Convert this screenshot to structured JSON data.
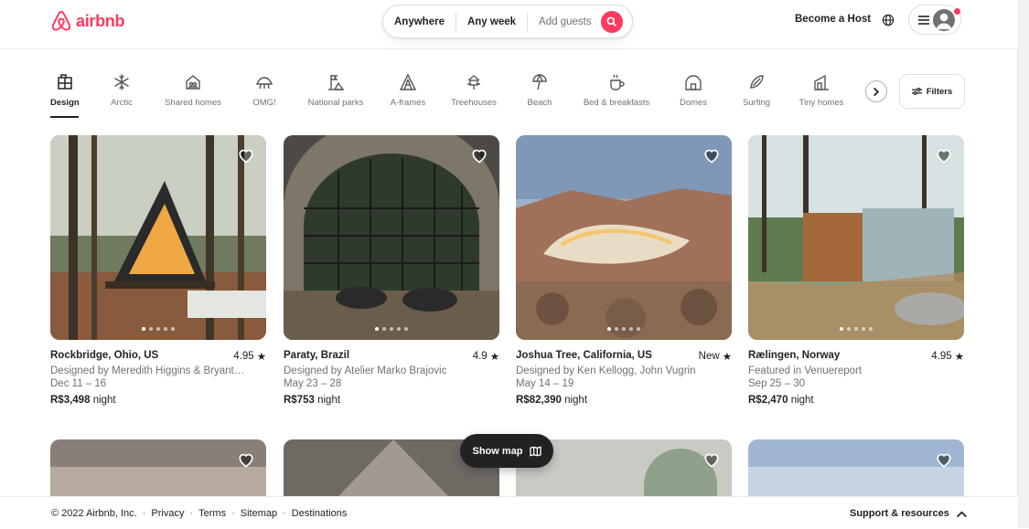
{
  "header": {
    "logo_text": "airbnb",
    "search": {
      "location": "Anywhere",
      "week": "Any week",
      "guests_placeholder": "Add guests"
    },
    "host_link": "Become a Host"
  },
  "categories": [
    {
      "label": "Design",
      "icon": "design-icon"
    },
    {
      "label": "Arctic",
      "icon": "snowflake-icon"
    },
    {
      "label": "Shared homes",
      "icon": "shared-home-icon"
    },
    {
      "label": "OMG!",
      "icon": "omg-icon"
    },
    {
      "label": "National parks",
      "icon": "national-park-icon"
    },
    {
      "label": "A-frames",
      "icon": "a-frame-icon"
    },
    {
      "label": "Treehouses",
      "icon": "treehouse-icon"
    },
    {
      "label": "Beach",
      "icon": "beach-umbrella-icon"
    },
    {
      "label": "Bed & breakfasts",
      "icon": "coffee-cup-icon"
    },
    {
      "label": "Domes",
      "icon": "dome-icon"
    },
    {
      "label": "Surfing",
      "icon": "surfboard-icon"
    },
    {
      "label": "Tiny homes",
      "icon": "tiny-home-icon"
    }
  ],
  "filters_label": "Filters",
  "listings": [
    {
      "title": "Rockbridge, Ohio, US",
      "rating": "4.95",
      "subtitle": "Designed by Meredith Higgins & Bryant…",
      "dates": "Dec 11 – 16",
      "price": "R$3,498",
      "price_unit": "night"
    },
    {
      "title": "Paraty, Brazil",
      "rating": "4.9",
      "subtitle": "Designed by Atelier Marko Brajovic",
      "dates": "May 23 – 28",
      "price": "R$753",
      "price_unit": "night"
    },
    {
      "title": "Joshua Tree, California, US",
      "rating": "New",
      "subtitle": "Designed by Ken Kellogg, John Vugrin",
      "dates": "May 14 – 19",
      "price": "R$82,390",
      "price_unit": "night"
    },
    {
      "title": "Rælingen, Norway",
      "rating": "4.95",
      "subtitle": "Featured in Venuereport",
      "dates": "Sep 25 – 30",
      "price": "R$2,470",
      "price_unit": "night"
    }
  ],
  "map_button": "Show map",
  "footer": {
    "copyright": "© 2022 Airbnb, Inc.",
    "links": [
      "Privacy",
      "Terms",
      "Sitemap",
      "Destinations"
    ],
    "support": "Support & resources"
  },
  "colors": {
    "brand": "#ff385c",
    "text": "#222222",
    "muted": "#717171"
  }
}
